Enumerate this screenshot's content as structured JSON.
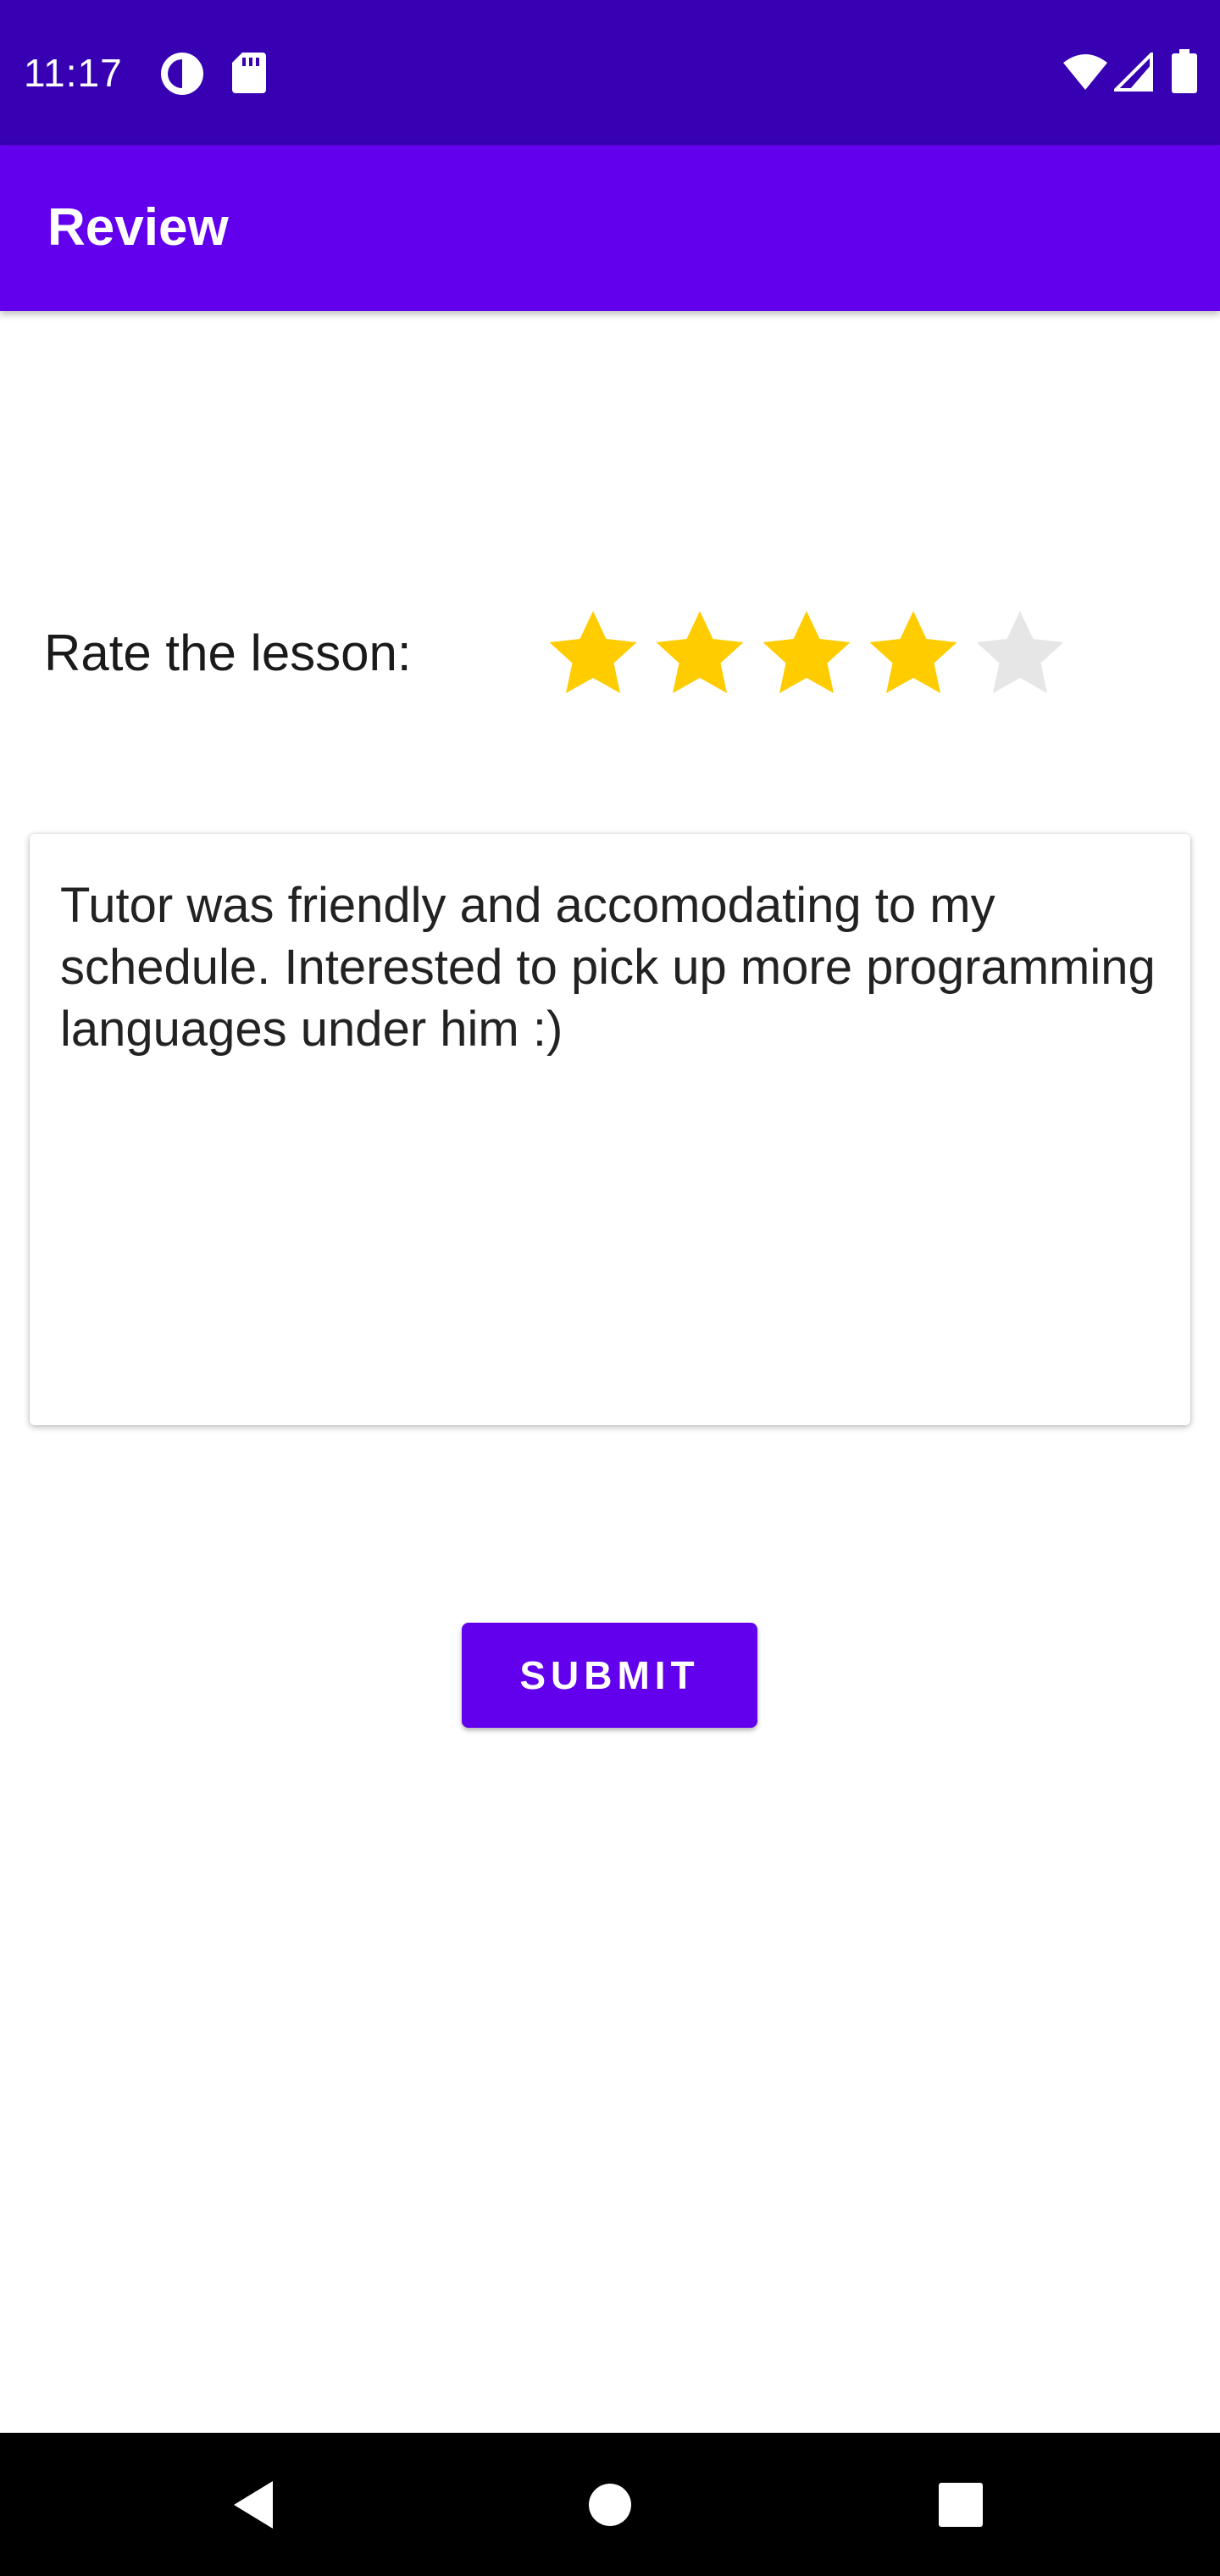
{
  "status_bar": {
    "time": "11:17",
    "background": "#3700b3",
    "left_icons": [
      "data-saver-icon",
      "sd-card-icon"
    ],
    "right_icons": [
      "wifi-icon",
      "signal-icon",
      "battery-icon"
    ]
  },
  "app_bar": {
    "title": "Review",
    "background": "#6200ee"
  },
  "rating": {
    "label": "Rate the lesson:",
    "value": 4,
    "max": 5,
    "filled_color": "#ffcc00",
    "empty_color": "#e6e6e6"
  },
  "review": {
    "text": "Tutor was friendly and accomodating to my schedule. Interested to pick up more programming languages under him :)"
  },
  "submit": {
    "label": "SUBMIT",
    "color": "#6200ee"
  },
  "nav_bar": {
    "buttons": [
      "back-icon",
      "home-icon",
      "recents-icon"
    ]
  }
}
